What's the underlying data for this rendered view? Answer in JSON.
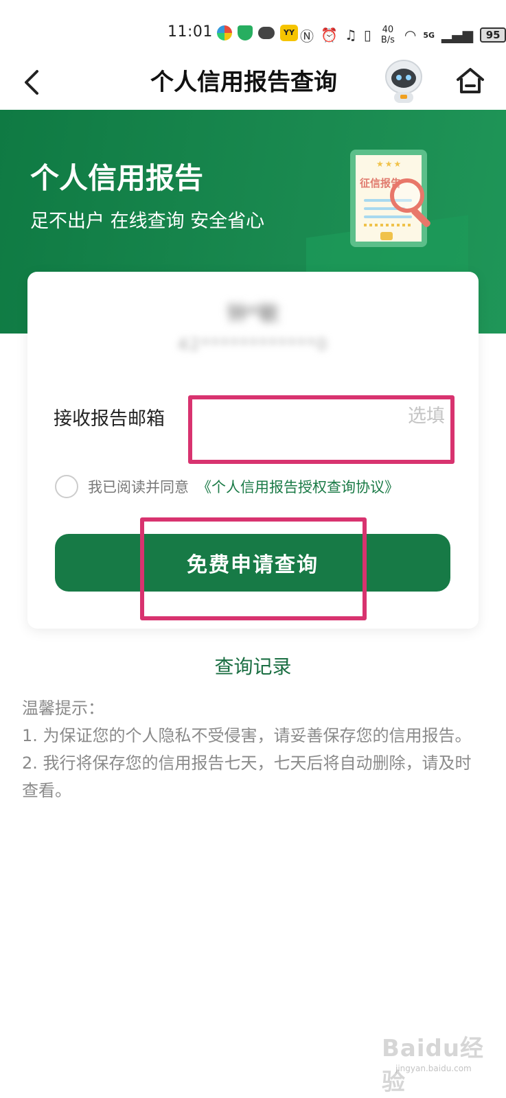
{
  "status_bar": {
    "time": "11:01",
    "net_speed_value": "40",
    "net_speed_unit": "B/s",
    "signal_label": "5G",
    "battery": "95"
  },
  "nav": {
    "title": "个人信用报告查询"
  },
  "banner": {
    "title": "个人信用报告",
    "subtitle": "足不出户 在线查询 安全省心",
    "report_label": "征信报告"
  },
  "card": {
    "user_name": "钟*敏",
    "user_id": "42************0",
    "email_label": "接收报告邮箱",
    "email_placeholder": "选填",
    "email_value": "",
    "agree_prefix": "我已阅读并同意",
    "agree_link": "《个人信用报告授权查询协议》",
    "submit_label": "免费申请查询"
  },
  "records_link": "查询记录",
  "tips": {
    "heading": "温馨提示：",
    "items": [
      "1. 为保证您的个人隐私不受侵害，请妥善保存您的信用报告。",
      "2. 我行将保存您的信用报告七天，七天后将自动删除，请及时查看。"
    ]
  },
  "watermark": {
    "brand": "Baidu经验",
    "url": "jingyan.baidu.com"
  },
  "colors": {
    "brand_green": "#177a46",
    "highlight_pink": "#d8336f"
  }
}
